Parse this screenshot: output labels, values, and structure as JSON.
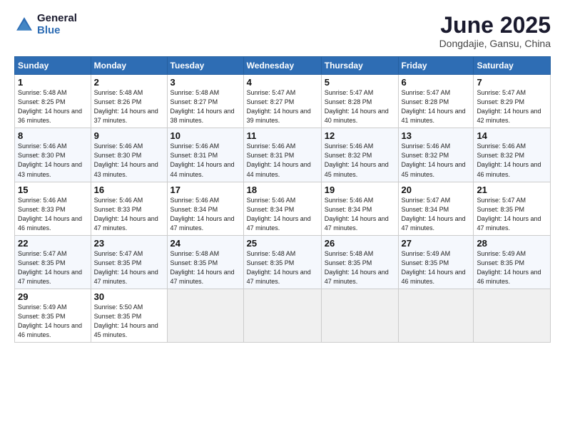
{
  "logo": {
    "general": "General",
    "blue": "Blue"
  },
  "header": {
    "month": "June 2025",
    "location": "Dongdajie, Gansu, China"
  },
  "weekdays": [
    "Sunday",
    "Monday",
    "Tuesday",
    "Wednesday",
    "Thursday",
    "Friday",
    "Saturday"
  ],
  "weeks": [
    [
      {
        "day": "1",
        "rise": "5:48 AM",
        "set": "8:25 PM",
        "hours": "14 hours and 36 minutes."
      },
      {
        "day": "2",
        "rise": "5:48 AM",
        "set": "8:26 PM",
        "hours": "14 hours and 37 minutes."
      },
      {
        "day": "3",
        "rise": "5:48 AM",
        "set": "8:27 PM",
        "hours": "14 hours and 38 minutes."
      },
      {
        "day": "4",
        "rise": "5:47 AM",
        "set": "8:27 PM",
        "hours": "14 hours and 39 minutes."
      },
      {
        "day": "5",
        "rise": "5:47 AM",
        "set": "8:28 PM",
        "hours": "14 hours and 40 minutes."
      },
      {
        "day": "6",
        "rise": "5:47 AM",
        "set": "8:28 PM",
        "hours": "14 hours and 41 minutes."
      },
      {
        "day": "7",
        "rise": "5:47 AM",
        "set": "8:29 PM",
        "hours": "14 hours and 42 minutes."
      }
    ],
    [
      {
        "day": "8",
        "rise": "5:46 AM",
        "set": "8:30 PM",
        "hours": "14 hours and 43 minutes."
      },
      {
        "day": "9",
        "rise": "5:46 AM",
        "set": "8:30 PM",
        "hours": "14 hours and 43 minutes."
      },
      {
        "day": "10",
        "rise": "5:46 AM",
        "set": "8:31 PM",
        "hours": "14 hours and 44 minutes."
      },
      {
        "day": "11",
        "rise": "5:46 AM",
        "set": "8:31 PM",
        "hours": "14 hours and 44 minutes."
      },
      {
        "day": "12",
        "rise": "5:46 AM",
        "set": "8:32 PM",
        "hours": "14 hours and 45 minutes."
      },
      {
        "day": "13",
        "rise": "5:46 AM",
        "set": "8:32 PM",
        "hours": "14 hours and 45 minutes."
      },
      {
        "day": "14",
        "rise": "5:46 AM",
        "set": "8:32 PM",
        "hours": "14 hours and 46 minutes."
      }
    ],
    [
      {
        "day": "15",
        "rise": "5:46 AM",
        "set": "8:33 PM",
        "hours": "14 hours and 46 minutes."
      },
      {
        "day": "16",
        "rise": "5:46 AM",
        "set": "8:33 PM",
        "hours": "14 hours and 47 minutes."
      },
      {
        "day": "17",
        "rise": "5:46 AM",
        "set": "8:34 PM",
        "hours": "14 hours and 47 minutes."
      },
      {
        "day": "18",
        "rise": "5:46 AM",
        "set": "8:34 PM",
        "hours": "14 hours and 47 minutes."
      },
      {
        "day": "19",
        "rise": "5:46 AM",
        "set": "8:34 PM",
        "hours": "14 hours and 47 minutes."
      },
      {
        "day": "20",
        "rise": "5:47 AM",
        "set": "8:34 PM",
        "hours": "14 hours and 47 minutes."
      },
      {
        "day": "21",
        "rise": "5:47 AM",
        "set": "8:35 PM",
        "hours": "14 hours and 47 minutes."
      }
    ],
    [
      {
        "day": "22",
        "rise": "5:47 AM",
        "set": "8:35 PM",
        "hours": "14 hours and 47 minutes."
      },
      {
        "day": "23",
        "rise": "5:47 AM",
        "set": "8:35 PM",
        "hours": "14 hours and 47 minutes."
      },
      {
        "day": "24",
        "rise": "5:48 AM",
        "set": "8:35 PM",
        "hours": "14 hours and 47 minutes."
      },
      {
        "day": "25",
        "rise": "5:48 AM",
        "set": "8:35 PM",
        "hours": "14 hours and 47 minutes."
      },
      {
        "day": "26",
        "rise": "5:48 AM",
        "set": "8:35 PM",
        "hours": "14 hours and 47 minutes."
      },
      {
        "day": "27",
        "rise": "5:49 AM",
        "set": "8:35 PM",
        "hours": "14 hours and 46 minutes."
      },
      {
        "day": "28",
        "rise": "5:49 AM",
        "set": "8:35 PM",
        "hours": "14 hours and 46 minutes."
      }
    ],
    [
      {
        "day": "29",
        "rise": "5:49 AM",
        "set": "8:35 PM",
        "hours": "14 hours and 46 minutes."
      },
      {
        "day": "30",
        "rise": "5:50 AM",
        "set": "8:35 PM",
        "hours": "14 hours and 45 minutes."
      },
      null,
      null,
      null,
      null,
      null
    ]
  ]
}
